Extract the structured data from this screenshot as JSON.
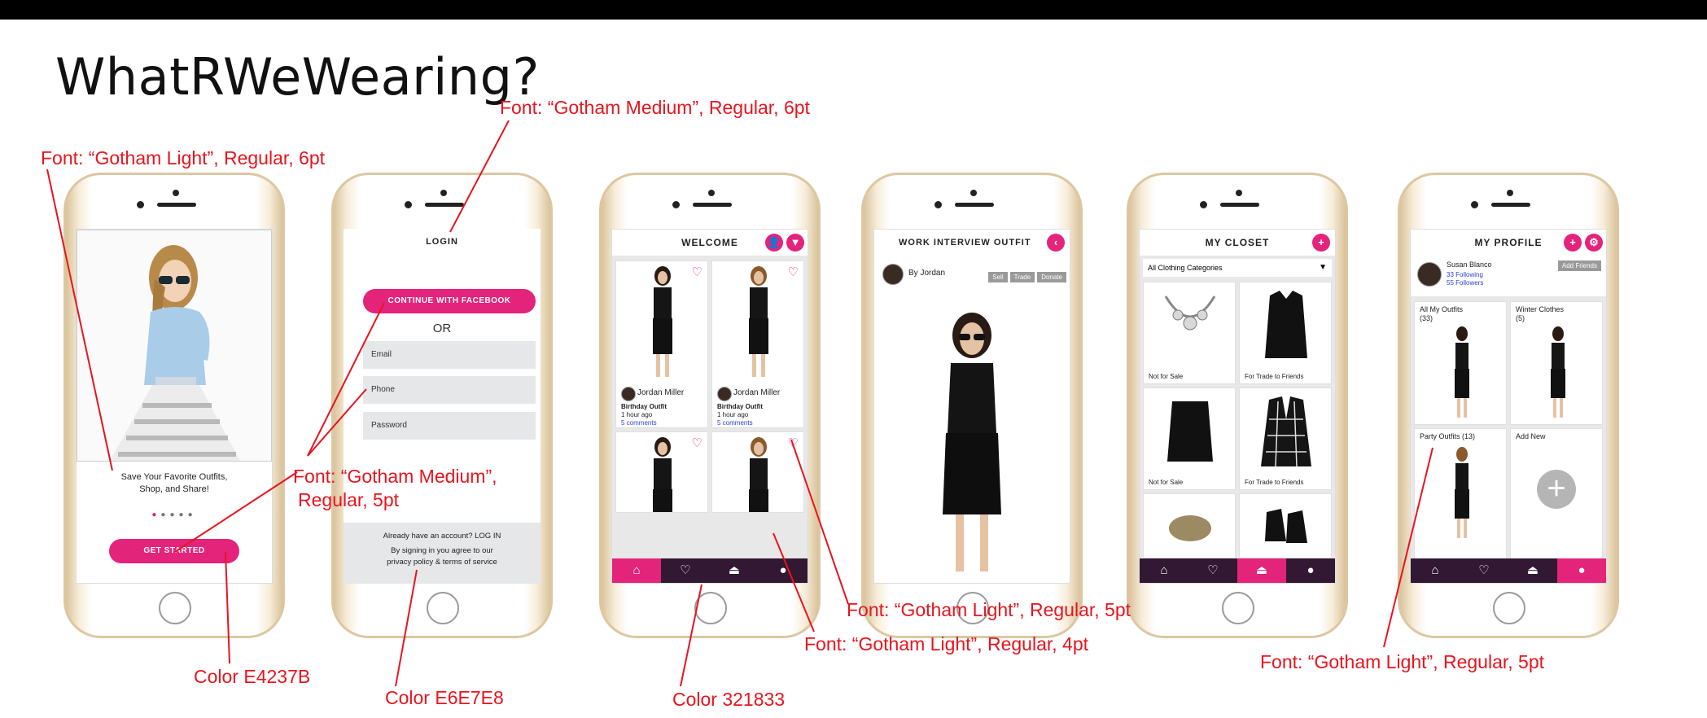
{
  "title": "WhatRWeWearing?",
  "colors": {
    "accent": "#E4237B",
    "field": "#E6E7E8",
    "nav": "#321833"
  },
  "annotations": {
    "a1": "Font: “Gotham Light”, Regular, 6pt",
    "a2": "Font: “Gotham Medium”, Regular, 6pt",
    "a3a": "Font: “Gotham Medium”,",
    "a3b": "Regular, 5pt",
    "a4": "Font: “Gotham Light”, Regular, 5pt",
    "a5": "Font: “Gotham Light”, Regular, 4pt",
    "a6": "Font: “Gotham Light”, Regular, 5pt",
    "c1": "Color E4237B",
    "c2": "Color E6E7E8",
    "c3": "Color 321833"
  },
  "onboarding": {
    "tagline1": "Save Your Favorite Outfits,",
    "tagline2": "Shop, and Share!",
    "cta": "GET STARTED"
  },
  "login": {
    "header": "LOGIN",
    "facebook": "CONTINUE WITH FACEBOOK",
    "or": "OR",
    "email_placeholder": "Email",
    "phone_placeholder": "Phone",
    "password_placeholder": "Password",
    "footer1": "Already have an account? LOG IN",
    "footer2": "By signing in you agree to our",
    "footer3": "privacy policy & terms of service"
  },
  "welcome": {
    "header": "WELCOME",
    "posts": [
      {
        "user": "Jordan Miller",
        "outfit": "Birthday Outfit",
        "time": "1 hour ago",
        "comments": "5 comments"
      },
      {
        "user": "Jordan Miller",
        "outfit": "Birthday Outfit",
        "time": "1 hour ago",
        "comments": "5 comments"
      }
    ]
  },
  "outfit": {
    "header": "WORK INTERVIEW OUTFIT",
    "by": "By Jordan",
    "sell": "Sell",
    "trade": "Trade",
    "donate": "Donate"
  },
  "closet": {
    "header": "MY CLOSET",
    "category": "All Clothing Categories",
    "items": [
      {
        "label": "Not for Sale"
      },
      {
        "label": "For Trade to Friends"
      },
      {
        "label": "Not for Sale"
      },
      {
        "label": "For Trade to Friends"
      }
    ]
  },
  "profile": {
    "header": "MY PROFILE",
    "name": "Susan Blanco",
    "following": "33 Following",
    "followers": "55 Followers",
    "add_friends": "Add Friends",
    "albums": [
      {
        "label": "All My Outfits",
        "count": "(33)"
      },
      {
        "label": "Winter Clothes",
        "count": "(5)"
      },
      {
        "label": "Party Outfits (13)"
      },
      {
        "label": "Add New"
      }
    ]
  },
  "nav_icons": [
    "home-icon",
    "chat-icon",
    "hanger-icon",
    "user-icon"
  ]
}
